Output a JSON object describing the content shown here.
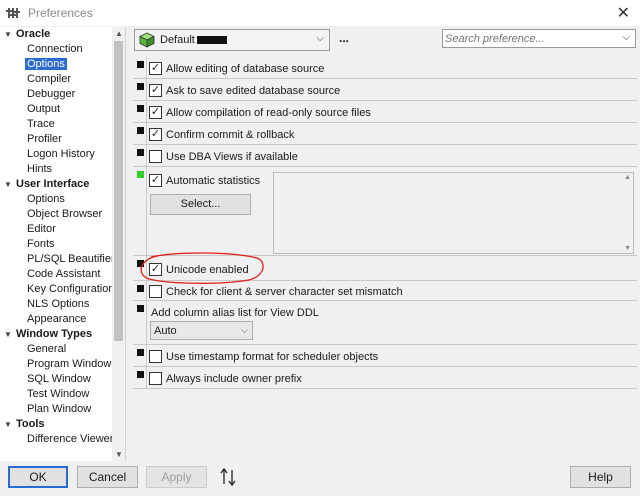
{
  "window": {
    "title": "Preferences",
    "close_glyph": "✕"
  },
  "tree": {
    "groups": [
      {
        "label": "Oracle",
        "items": [
          "Connection",
          "Options",
          "Compiler",
          "Debugger",
          "Output",
          "Trace",
          "Profiler",
          "Logon History",
          "Hints"
        ]
      },
      {
        "label": "User Interface",
        "items": [
          "Options",
          "Object Browser",
          "Editor",
          "Fonts",
          "PL/SQL Beautifier",
          "Code Assistant",
          "Key Configuration",
          "NLS Options",
          "Appearance"
        ]
      },
      {
        "label": "Window Types",
        "items": [
          "General",
          "Program Window",
          "SQL Window",
          "Test Window",
          "Plan Window"
        ]
      },
      {
        "label": "Tools",
        "items": [
          "Difference Viewer"
        ]
      }
    ],
    "selected_item": "Options"
  },
  "toolbar": {
    "profile_value": "Default",
    "more_label": "...",
    "search_placeholder": "Search preference..."
  },
  "options": {
    "allow_edit_db_source": {
      "label": "Allow editing of database source",
      "checked": true
    },
    "ask_save_edited": {
      "label": "Ask to save edited database source",
      "checked": true
    },
    "allow_compile_readonly": {
      "label": "Allow compilation of read-only source files",
      "checked": true
    },
    "confirm_commit": {
      "label": "Confirm commit & rollback",
      "checked": true
    },
    "use_dba_views": {
      "label": "Use DBA Views if available",
      "checked": false
    },
    "automatic_statistics": {
      "label": "Automatic statistics",
      "checked": true,
      "select_label": "Select..."
    },
    "unicode_enabled": {
      "label": "Unicode enabled",
      "checked": true
    },
    "check_charset_mismatch": {
      "label": "Check for client & server character set mismatch",
      "checked": false
    },
    "column_alias": {
      "label": "Add column alias list for View DDL",
      "value": "Auto"
    },
    "timestamp_format": {
      "label": "Use timestamp format for scheduler objects",
      "checked": false
    },
    "include_owner_prefix": {
      "label": "Always include owner prefix",
      "checked": false
    }
  },
  "footer": {
    "ok_label": "OK",
    "cancel_label": "Cancel",
    "apply_label": "Apply",
    "help_label": "Help"
  },
  "colors": {
    "selection": "#2a6bd2",
    "annotation_red": "#e0201b",
    "changed_marker": "#2fd12f"
  }
}
